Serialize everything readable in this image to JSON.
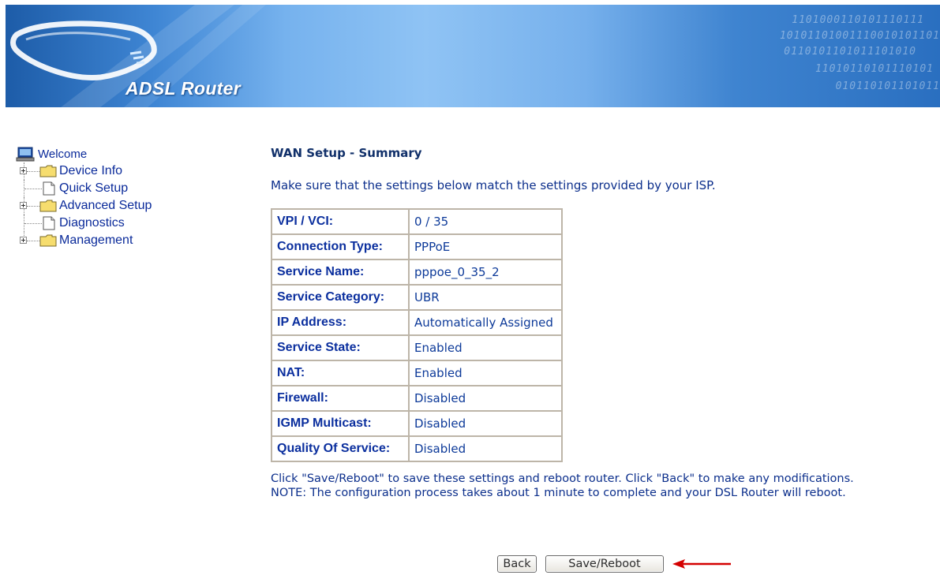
{
  "header": {
    "brand": "ADSL Router",
    "binary_lines": [
      "1101000110101110111",
      "10101101001110010101101",
      "0110101101011101010",
      "11010110101110101",
      "010110101101011"
    ]
  },
  "nav": {
    "welcome": "Welcome",
    "items": [
      {
        "label": "Device Info",
        "type": "folder",
        "expandable": true
      },
      {
        "label": "Quick Setup",
        "type": "page",
        "expandable": false
      },
      {
        "label": "Advanced Setup",
        "type": "folder",
        "expandable": true
      },
      {
        "label": "Diagnostics",
        "type": "page",
        "expandable": false
      },
      {
        "label": "Management",
        "type": "folder",
        "expandable": true
      }
    ]
  },
  "main": {
    "title": "WAN Setup - Summary",
    "intro": "Make sure that the settings below match the settings provided by your ISP.",
    "rows": [
      {
        "key": "VPI / VCI:",
        "value": "0 / 35"
      },
      {
        "key": "Connection Type:",
        "value": "PPPoE"
      },
      {
        "key": "Service Name:",
        "value": "pppoe_0_35_2"
      },
      {
        "key": "Service Category:",
        "value": "UBR"
      },
      {
        "key": "IP Address:",
        "value": "Automatically Assigned"
      },
      {
        "key": "Service State:",
        "value": "Enabled"
      },
      {
        "key": "NAT:",
        "value": "Enabled"
      },
      {
        "key": "Firewall:",
        "value": "Disabled"
      },
      {
        "key": "IGMP Multicast:",
        "value": "Disabled"
      },
      {
        "key": "Quality Of Service:",
        "value": "Disabled"
      }
    ],
    "note_line1": "Click \"Save/Reboot\" to save these settings and reboot router. Click \"Back\" to make any modifications.",
    "note_line2": "NOTE: The configuration process takes about 1 minute to complete and your DSL Router will reboot.",
    "back_label": "Back",
    "save_label": "Save/Reboot"
  },
  "colors": {
    "link_blue": "#0b2f9e",
    "title_navy": "#11306a",
    "arrow_red": "#d40000",
    "banner_blue": "#3f86d4"
  },
  "icons": {
    "welcome": "computer-icon",
    "folder": "folder-icon",
    "page": "document-icon",
    "expander": "plus-box-icon",
    "annotation": "red-arrow-icon"
  }
}
